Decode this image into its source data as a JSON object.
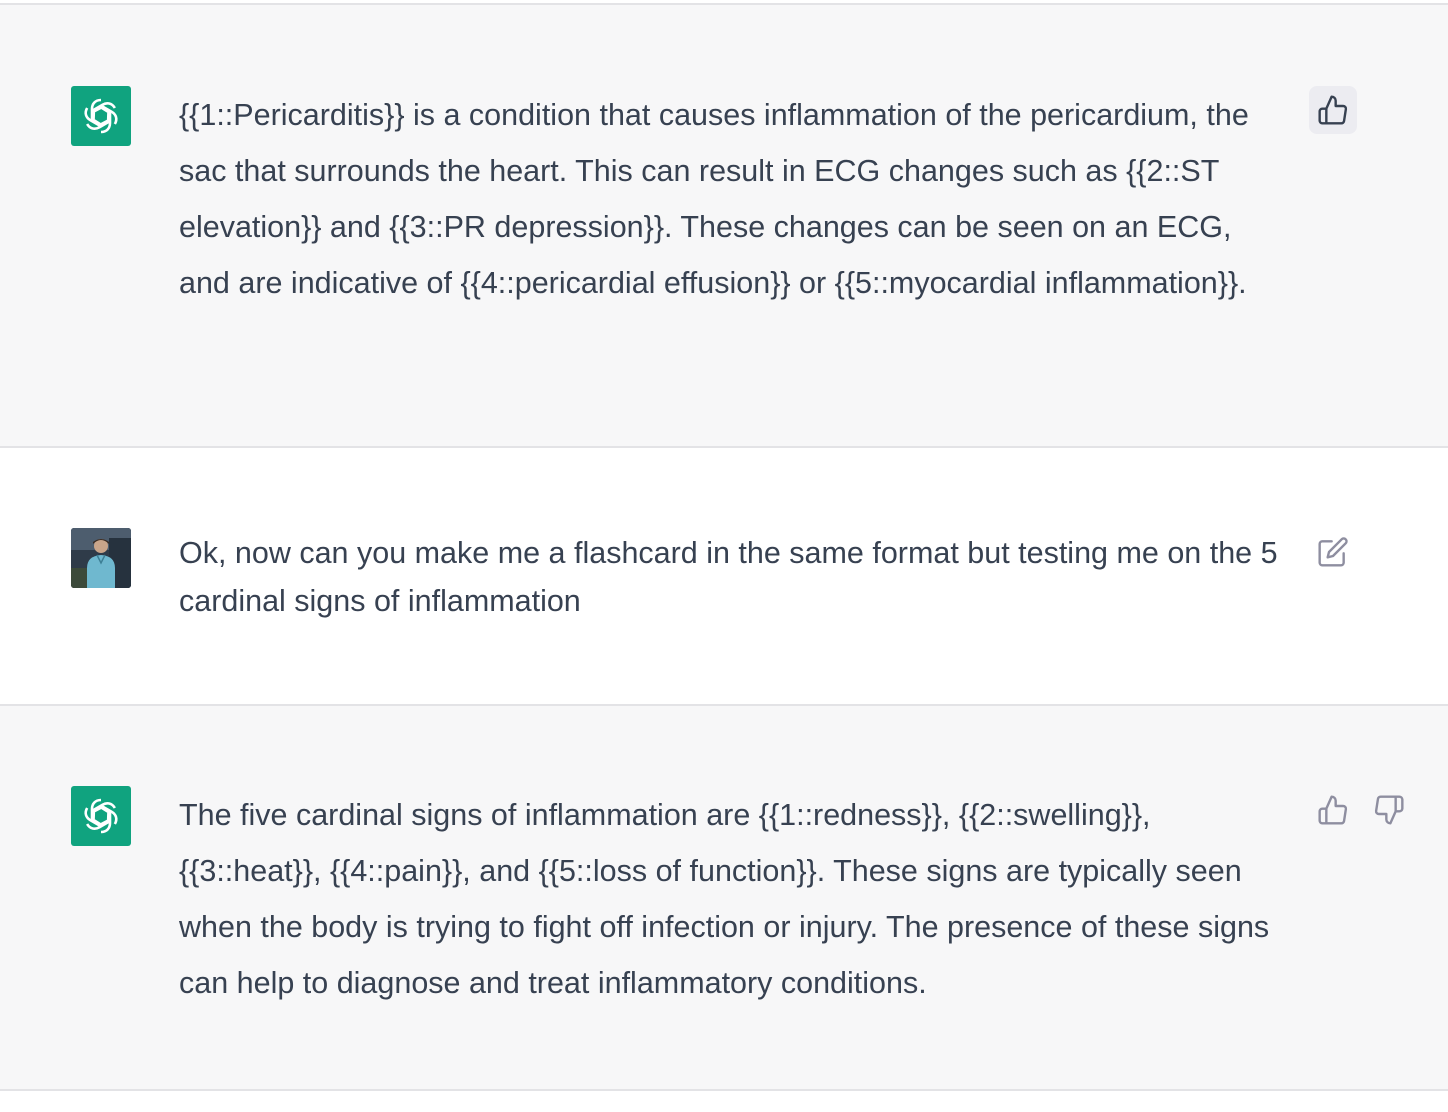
{
  "messages": [
    {
      "role": "assistant",
      "avatar_icon": "openai-logo-icon",
      "text": "{{1::Pericarditis}} is a condition that causes inflammation of the pericardium, the sac that surrounds the heart. This can result in ECG changes such as {{2::ST elevation}} and {{3::PR depression}}. These changes can be seen on an ECG, and are indicative of {{4::pericardial effusion}} or {{5::myocardial inflammation}}.",
      "actions": [
        "thumbs-up-icon"
      ],
      "thumbs_up_active": true
    },
    {
      "role": "user",
      "avatar_icon": "user-photo-avatar",
      "text": "Ok, now can you make me a flashcard in the same format but testing me on the 5 cardinal signs of inflammation",
      "actions": [
        "edit-icon"
      ]
    },
    {
      "role": "assistant",
      "avatar_icon": "openai-logo-icon",
      "text": "The five cardinal signs of inflammation are {{1::redness}}, {{2::swelling}}, {{3::heat}}, {{4::pain}}, and {{5::loss of function}}. These signs are typically seen when the body is trying to fight off infection or injury. The presence of these signs can help to diagnose and treat inflammatory conditions.",
      "actions": [
        "thumbs-up-icon",
        "thumbs-down-icon"
      ]
    }
  ],
  "colors": {
    "assistant_bg": "#f7f7f8",
    "user_bg": "#ffffff",
    "brand_green": "#10a37f",
    "text": "#374151",
    "icon": "#8e8ea0"
  }
}
